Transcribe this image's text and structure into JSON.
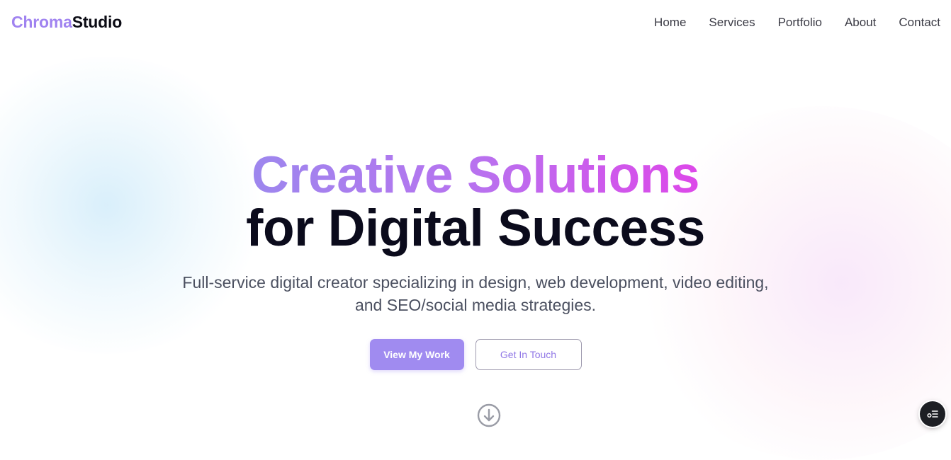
{
  "brand": {
    "part1": "Chroma",
    "part2": "Studio"
  },
  "nav": {
    "items": [
      {
        "label": "Home"
      },
      {
        "label": "Services"
      },
      {
        "label": "Portfolio"
      },
      {
        "label": "About"
      },
      {
        "label": "Contact"
      }
    ]
  },
  "hero": {
    "title_line1": "Creative Solutions",
    "title_line2": "for Digital Success",
    "subtitle": "Full-service digital creator specializing in design, web development, video editing, and SEO/social media strategies.",
    "primary_button": "View My Work",
    "secondary_button": "Get In Touch"
  },
  "icons": {
    "scroll": "arrow-down-circle-icon",
    "fab": "toggle-list-icon"
  },
  "colors": {
    "accent": "#a08bf0",
    "gradient_start": "#9d87ee",
    "gradient_end": "#dd48e9",
    "heading": "#0b0b1c",
    "body_text": "#4b5060"
  }
}
